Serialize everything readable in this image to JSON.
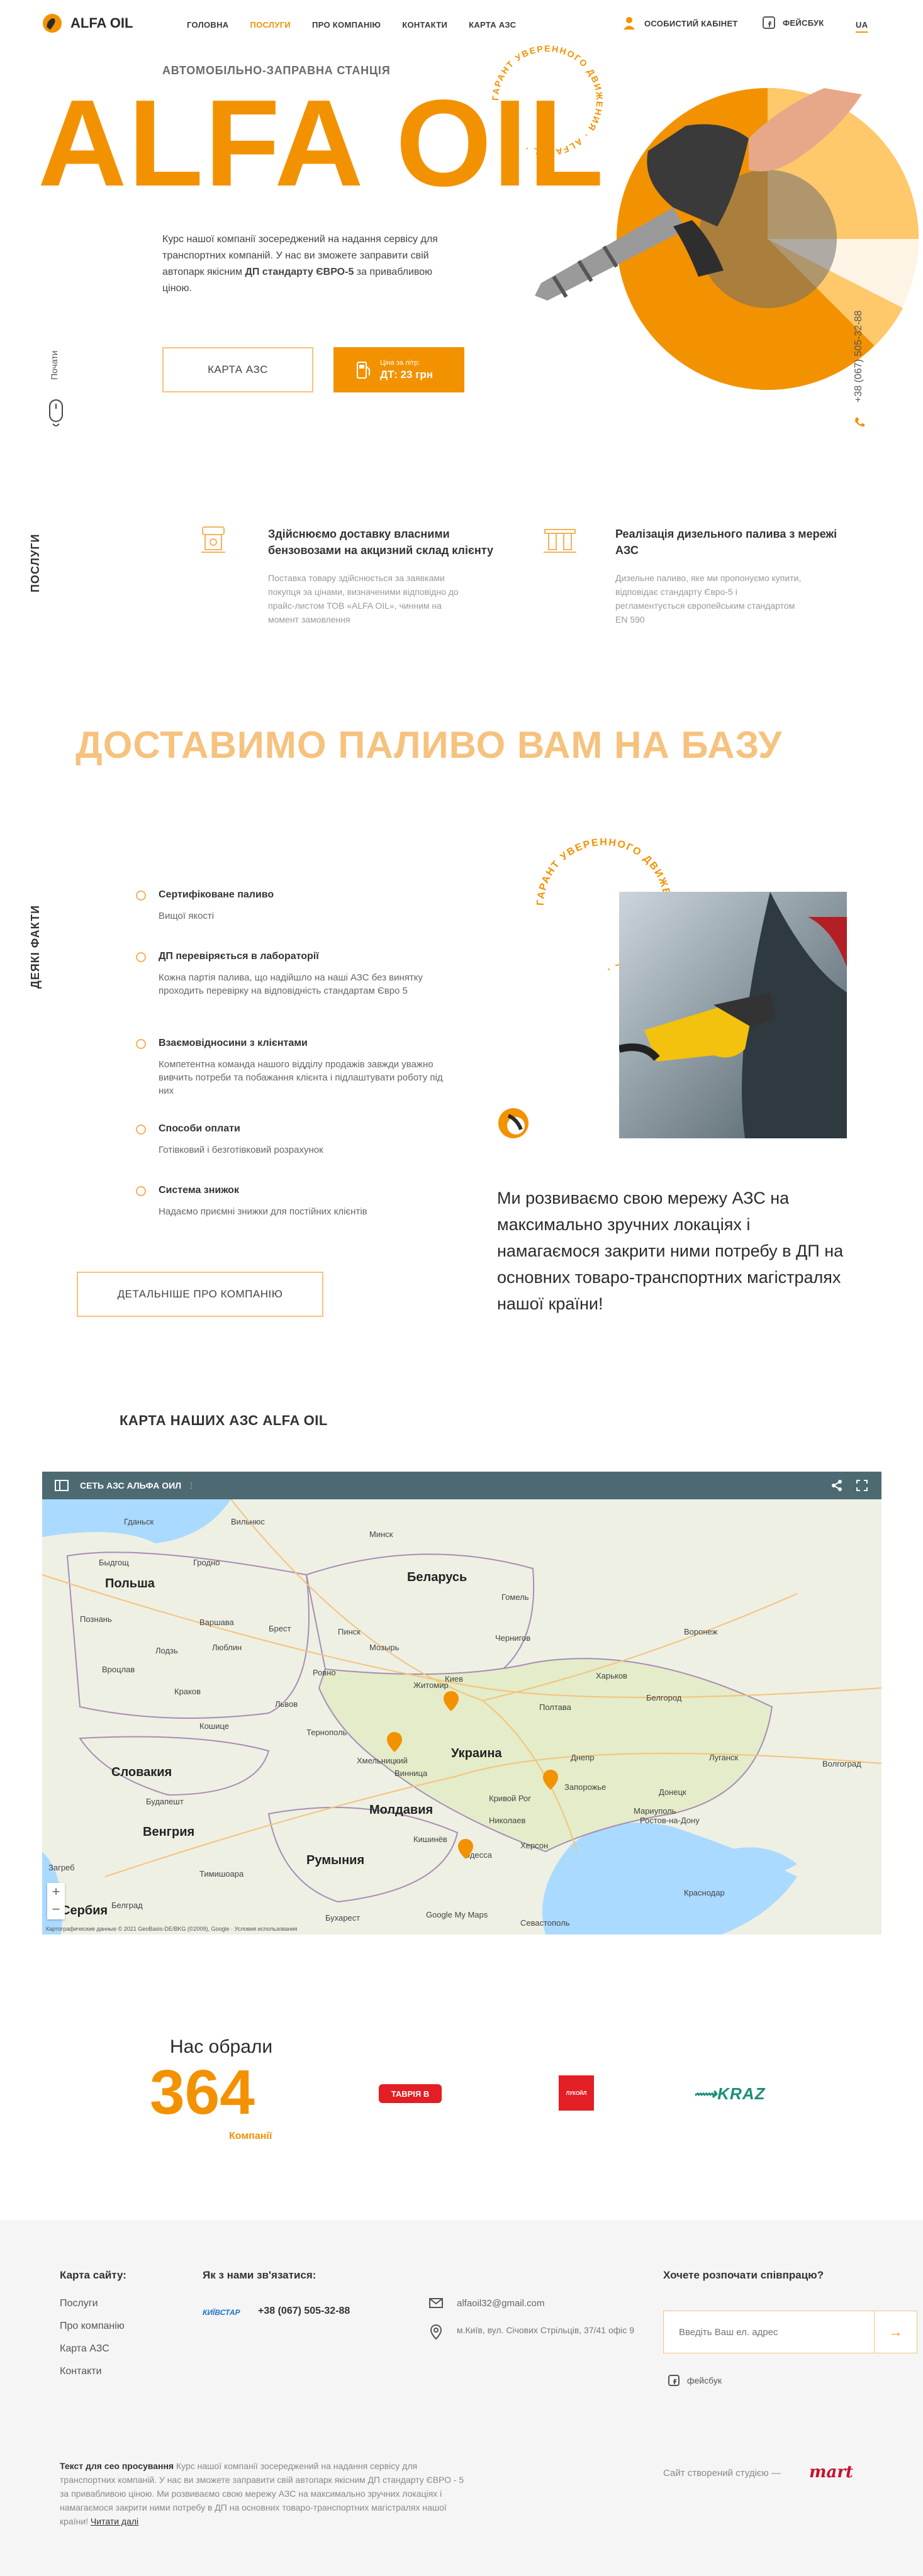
{
  "header": {
    "logo_text": "ALFA OIL",
    "nav": [
      "ГОЛОВНА",
      "ПОСЛУГИ",
      "ПРО КОМПАНІЮ",
      "КОНТАКТИ",
      "КАРТА АЗС"
    ],
    "cabinet": "ОСОБИСТИЙ КАБІНЕТ",
    "facebook": "ФЕЙСБУК",
    "lang": "UA"
  },
  "hero": {
    "subtitle": "АВТОМОБІЛЬНО-ЗАПРАВНА СТАНЦІЯ",
    "title": "ALFA OIL",
    "circle_text": "ГАРАНТ УВЕРЕННОГО ДВИЖЕНИЯ · ALFA OIL ·",
    "desc_pre": "Курс нашої компанії зосереджений на надання сервісу для транспортних компаній. У нас ви зможете заправити свій автопарк якісним ",
    "desc_bold": "ДП стандарту ЄВРО-5",
    "desc_post": " за привабливою ціною.",
    "btn_map": "КАРТА АЗС",
    "price_label": "Ціна за літр:",
    "price_value": "ДТ: 23 грн",
    "scroll": "Почати",
    "phone": "+38 (067) 505-32-88"
  },
  "services": {
    "section_label": "ПОСЛУГИ",
    "items": [
      {
        "title": "Здійснюємо доставку власними бензовозами на акцизний склад клієнту",
        "text": "Поставка товару здійснюється за заявками покупця за цінами, визначеними відповідно до прайс-листом ТОВ «ALFA OIL», чинним на момент замовлення"
      },
      {
        "title": "Реалізація дизельного палива з мережі АЗС",
        "text": "Дизельне паливо, яке ми пропонуємо купити, відповідає стандарту Євро-5 і регламентується європейським стандартом EN 590"
      }
    ]
  },
  "delivery": {
    "title": "ДОСТАВИМО ПАЛИВО ВАМ НА БАЗУ"
  },
  "facts": {
    "section_label": "ДЕЯКІ ФАКТИ",
    "items": [
      {
        "title": "Сертифіковане паливо",
        "text": "Вищої якості"
      },
      {
        "title": "ДП перевіряється в лабораторії",
        "text": "Кожна партія палива, що надійшло на нашi АЗС без винятку проходить перевірку на відповідність стандартам Євро 5"
      },
      {
        "title": "Взаємовідносини з клієнтами",
        "text": "Компетентна команда нашого відділу продажів завжди уважно вивчить потреби та побажання клієнта і підлаштувати роботу під них"
      },
      {
        "title": "Способи оплати",
        "text": "Готівковий і безготівковий розрахунок"
      },
      {
        "title": "Система знижок",
        "text": "Надаємо приємні знижки для постійних клієнтів"
      }
    ],
    "btn": "ДЕТАЛЬНІШЕ ПРО КОМПАНІЮ",
    "circle_text": "ГАРАНТ УВЕРЕННОГО ДВИЖЕНИЯ · ALFA OIL ·",
    "paragraph": "Ми розвиваємо свою мережу АЗС на максимально зручних локаціях і намагаємося закрити ними потребу в ДП на основних товаро-транспортних магістралях нашої країни!"
  },
  "map": {
    "section_title": "КАРТА НАШИХ АЗС ALFA OIL",
    "bar_title": "СЕТЬ АЗС АЛЬФА ОИЛ",
    "labels": [
      "Гданьск",
      "Вильнюс",
      "Минск",
      "Быдгощ",
      "Гродно",
      "Польша",
      "Беларусь",
      "Гомель",
      "Познань",
      "Варшава",
      "Брест",
      "Пинск",
      "Лодзь",
      "Люблин",
      "Мозырь",
      "Воронеж",
      "Чернигов",
      "Вроцлав",
      "Ровно",
      "Житомир",
      "Киев",
      "Харьков",
      "Краков",
      "Львов",
      "Белгород",
      "Полтава",
      "Кошице",
      "Тернополь",
      "Хмельницкий",
      "Украина",
      "Днепр",
      "Луганск",
      "Словакия",
      "Винница",
      "Запорожье",
      "Ростов-на-Дону",
      "Донецк",
      "Волгоград",
      "Будапешт",
      "Молдавия",
      "Кривой Рог",
      "Мариуполь",
      "Венгрия",
      "Кишинёв",
      "Николаев",
      "Херсон",
      "Краснодар",
      "Одесса",
      "Загреб",
      "Тимишоара",
      "Румыния",
      "Сербия",
      "Белград",
      "Бухарест",
      "Севастополь",
      "Google My Maps"
    ],
    "footer_note": "Картографические данные © 2021 GeoBasis-DE/BKG (©2009), Google · Условия использования"
  },
  "clients": {
    "title": "Нас обрали",
    "number": "364",
    "label": "Компанії",
    "logos": [
      "ТАВРІЯ В",
      "ЛУКОЙЛ",
      "KRAZ"
    ]
  },
  "footer": {
    "sitemap_title": "Карта сайту:",
    "sitemap": [
      "Послуги",
      "Про компанію",
      "Карта АЗС",
      "Контакти"
    ],
    "contact_title": "Як з нами зв'язатися:",
    "operator": "КИЇВСТАР",
    "phone": "+38 (067) 505-32-88",
    "email": "alfaoil32@gmail.com",
    "address": "м.Київ, вул. Січових Стрільців, 37/41 офіс 9",
    "cta_title": "Хочете розпочати співпрацю?",
    "input_placeholder": "Введіть Ваш ел. адрес",
    "facebook": "фейсбук",
    "seo_bold": "Текст для сео просування",
    "seo_text": " Курс нашої компанії зосереджений на надання сервісу для транспортних компаній. У нас ви зможете заправити свій автопарк якісним ДП стандарту ЄВРО - 5 за привабливою ціною. Ми розвиваємо свою мережу АЗС на максимально зручних локаціях і намагаємося закрити ними потребу в ДП на основних товаро-транспортних магістралях нашої країни! ",
    "seo_link": "Читати далі",
    "credit": "Сайт створений студією —",
    "studio": "mart"
  },
  "colors": {
    "accent": "#f39200",
    "accent_light": "#f7c37a",
    "map_bar": "#4d6a72"
  }
}
